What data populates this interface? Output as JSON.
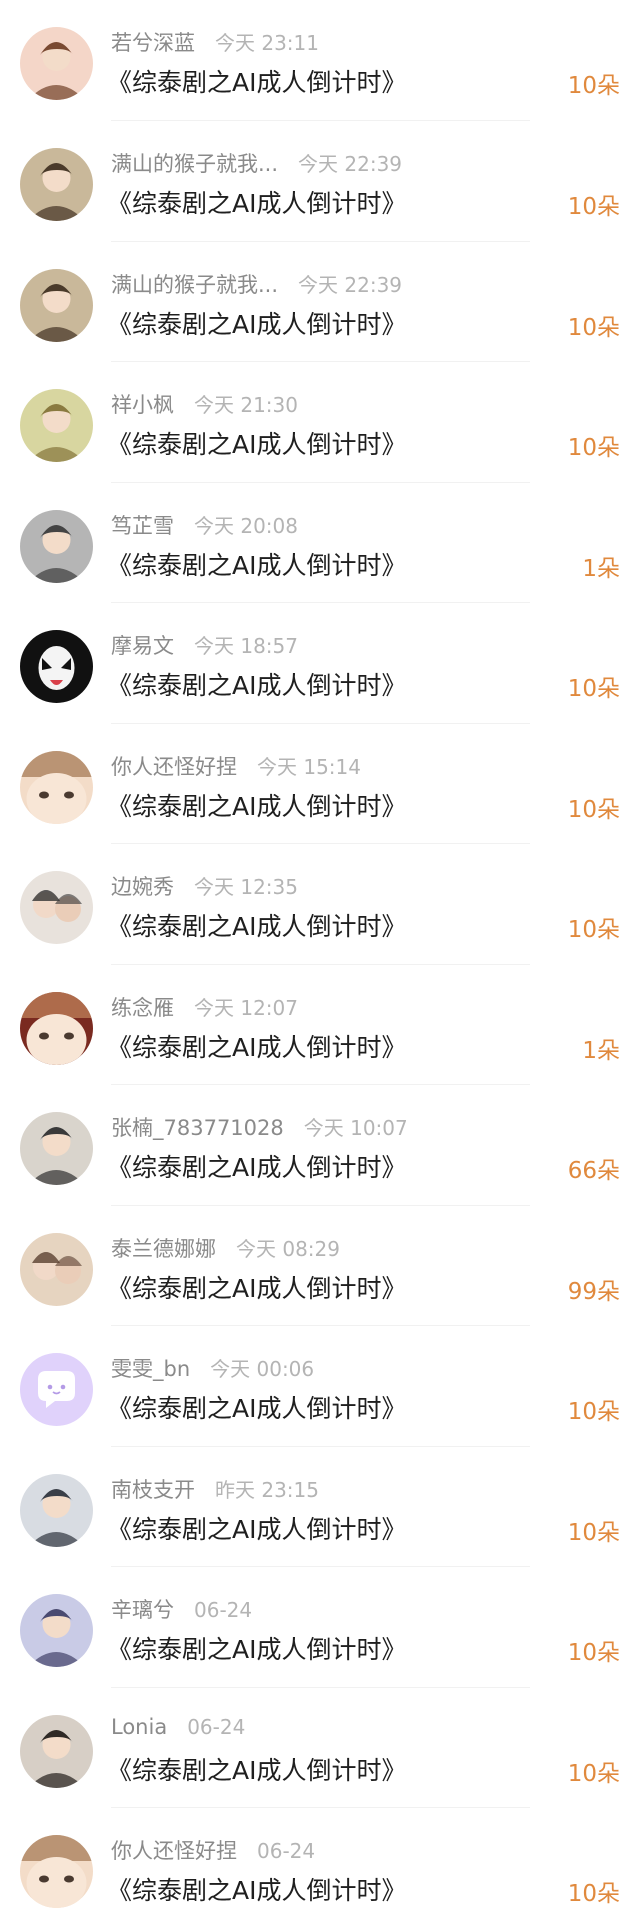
{
  "items": [
    {
      "username": "若兮深蓝",
      "time": "今天 23:11",
      "title": "《综泰剧之AI成人倒计时》",
      "count": "10朵",
      "avatar": {
        "icon": "avatar-girl-icon",
        "bg": "#f4d6c8",
        "fg": "#7a4a32"
      }
    },
    {
      "username": "满山的猴子就我...",
      "time": "今天 22:39",
      "title": "《综泰剧之AI成人倒计时》",
      "count": "10朵",
      "avatar": {
        "icon": "avatar-portrait-icon",
        "bg": "#c9b89a",
        "fg": "#4a3a2a"
      }
    },
    {
      "username": "满山的猴子就我...",
      "time": "今天 22:39",
      "title": "《综泰剧之AI成人倒计时》",
      "count": "10朵",
      "avatar": {
        "icon": "avatar-portrait-icon",
        "bg": "#c9b89a",
        "fg": "#4a3a2a"
      }
    },
    {
      "username": "祥小枫",
      "time": "今天 21:30",
      "title": "《综泰剧之AI成人倒计时》",
      "count": "10朵",
      "avatar": {
        "icon": "avatar-illustration-icon",
        "bg": "#d8d6a0",
        "fg": "#8a7a40"
      }
    },
    {
      "username": "笃芷雪",
      "time": "今天 20:08",
      "title": "《综泰剧之AI成人倒计时》",
      "count": "1朵",
      "avatar": {
        "icon": "avatar-person-icon",
        "bg": "#b5b5b5",
        "fg": "#444444"
      }
    },
    {
      "username": "摩易文",
      "time": "今天 18:57",
      "title": "《综泰剧之AI成人倒计时》",
      "count": "10朵",
      "avatar": {
        "icon": "avatar-mask-icon",
        "bg": "#111111",
        "fg": "#ffffff"
      }
    },
    {
      "username": "你人还怪好捏",
      "time": "今天 15:14",
      "title": "《综泰剧之AI成人倒计时》",
      "count": "10朵",
      "avatar": {
        "icon": "avatar-anime-icon",
        "bg": "#f3dcc8",
        "fg": "#8a5a30"
      }
    },
    {
      "username": "边婉秀",
      "time": "今天 12:35",
      "title": "《综泰剧之AI成人倒计时》",
      "count": "10朵",
      "avatar": {
        "icon": "avatar-couple-icon",
        "bg": "#e8e2dc",
        "fg": "#333333"
      }
    },
    {
      "username": "练念雁",
      "time": "今天 12:07",
      "title": "《综泰剧之AI成人倒计时》",
      "count": "1朵",
      "avatar": {
        "icon": "avatar-anime-icon",
        "bg": "#7a2a20",
        "fg": "#d8a070"
      }
    },
    {
      "username": "张楠_783771028",
      "time": "今天 10:07",
      "title": "《综泰剧之AI成人倒计时》",
      "count": "66朵",
      "avatar": {
        "icon": "avatar-person-icon",
        "bg": "#d9d4cc",
        "fg": "#3a3a3a"
      }
    },
    {
      "username": "泰兰德娜娜",
      "time": "今天 08:29",
      "title": "《综泰剧之AI成人倒计时》",
      "count": "99朵",
      "avatar": {
        "icon": "avatar-couple-icon",
        "bg": "#e6d4c0",
        "fg": "#5a4030"
      }
    },
    {
      "username": "雯雯_bn",
      "time": "今天 00:06",
      "title": "《综泰剧之AI成人倒计时》",
      "count": "10朵",
      "avatar": {
        "icon": "chat-bubble-icon",
        "bg": "#e0d2fb",
        "fg": "#ffffff"
      }
    },
    {
      "username": "南枝支开",
      "time": "昨天 23:15",
      "title": "《综泰剧之AI成人倒计时》",
      "count": "10朵",
      "avatar": {
        "icon": "avatar-person-icon",
        "bg": "#d8dce2",
        "fg": "#3a3f48"
      }
    },
    {
      "username": "辛璃兮",
      "time": "06-24",
      "title": "《综泰剧之AI成人倒计时》",
      "count": "10朵",
      "avatar": {
        "icon": "avatar-girl-icon",
        "bg": "#c9cbe6",
        "fg": "#4a4a70"
      }
    },
    {
      "username": "Lonia",
      "time": "06-24",
      "title": "《综泰剧之AI成人倒计时》",
      "count": "10朵",
      "avatar": {
        "icon": "avatar-person-icon",
        "bg": "#d7cfc6",
        "fg": "#2f2a26"
      }
    },
    {
      "username": "你人还怪好捏",
      "time": "06-24",
      "title": "《综泰剧之AI成人倒计时》",
      "count": "10朵",
      "avatar": {
        "icon": "avatar-anime-icon",
        "bg": "#f3dcc8",
        "fg": "#8a5a30"
      }
    }
  ]
}
